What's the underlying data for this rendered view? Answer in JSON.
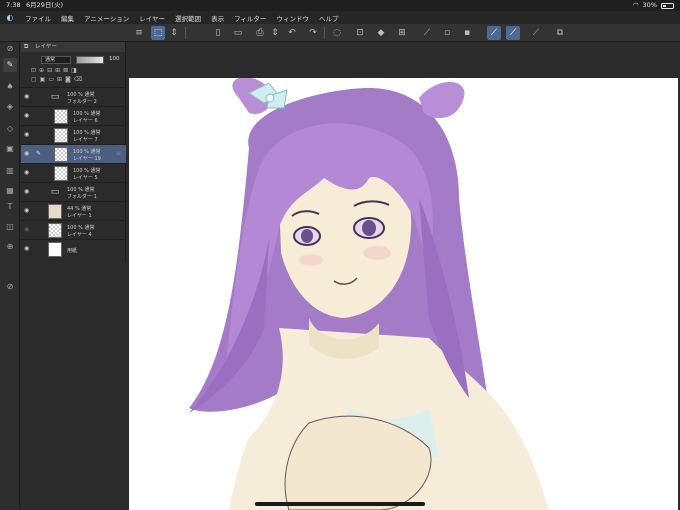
{
  "status": {
    "time": "7:38",
    "date": "6月29日(火)",
    "battery": "30%"
  },
  "menu": [
    "ファイル",
    "編集",
    "アニメーション",
    "レイヤー",
    "選択範囲",
    "表示",
    "フィルター",
    "ウィンドウ",
    "ヘルプ"
  ],
  "toolbar_icons": [
    "menu-icon",
    "transform-icon",
    "spinner-icon",
    "new-file-icon",
    "open-icon",
    "save-icon",
    "export-icon",
    "undo-icon",
    "redo-icon",
    "lasso-icon",
    "select-icon",
    "fill-icon",
    "crop-icon",
    "ruler-icon",
    "snap-icon",
    "stabilize-icon",
    "pen-settings-icon",
    "brush-size-icon",
    "eraser-settings-icon",
    "share-icon"
  ],
  "tools": [
    "eyedropper-icon",
    "pen-tool-icon",
    "brush-icon",
    "airbrush-icon",
    "eraser-icon",
    "fill-tool-icon",
    "gradient-icon",
    "figure-icon",
    "text-icon",
    "frame-icon",
    "balloon-icon",
    "layer-move-icon",
    "operation-icon"
  ],
  "layer_panel": {
    "title": "レイヤー",
    "blend_mode": "通常",
    "opacity": "100",
    "layers": [
      {
        "line1": "100 % 通常",
        "line2": "フォルダー 2",
        "kind": "folder",
        "selected": false
      },
      {
        "line1": "100 % 通常",
        "line2": "レイヤー 6",
        "kind": "raster",
        "selected": false
      },
      {
        "line1": "100 % 通常",
        "line2": "レイヤー 7",
        "kind": "raster",
        "selected": false
      },
      {
        "line1": "100 % 通常",
        "line2": "レイヤー 19",
        "kind": "raster",
        "selected": true
      },
      {
        "line1": "100 % 通常",
        "line2": "レイヤー 5",
        "kind": "raster",
        "selected": false
      },
      {
        "line1": "100 % 通常",
        "line2": "フォルダー 1",
        "kind": "folder",
        "selected": false
      },
      {
        "line1": "44 % 通常",
        "line2": "レイヤー 1",
        "kind": "raster",
        "selected": false
      },
      {
        "line1": "100 % 通常",
        "line2": "レイヤー 4",
        "kind": "raster",
        "selected": false
      },
      {
        "line1": "",
        "line2": "用紙",
        "kind": "paper",
        "selected": false
      }
    ]
  },
  "colors": {
    "accent": "#4e6a92",
    "hair": "#b48ad0",
    "hair_shadow": "#8b5fae",
    "skin": "#f6ecd9",
    "ribbon": "#cfeef0"
  }
}
